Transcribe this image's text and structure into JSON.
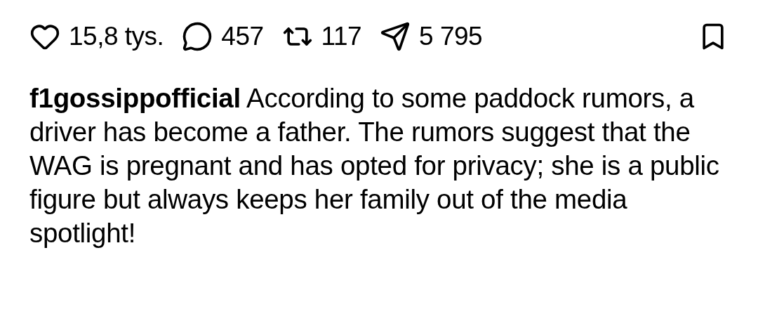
{
  "actions": [
    {
      "kind": "like",
      "count": "15,8 tys."
    },
    {
      "kind": "comment",
      "count": "457"
    },
    {
      "kind": "repost",
      "count": "117"
    },
    {
      "kind": "share",
      "count": "5 795"
    }
  ],
  "bookmark": {
    "kind": "save"
  },
  "caption": "**f1gossippofficial** According to some paddock rumors, a driver has become a father. The rumors suggest that the WAG is pregnant and has opted for privacy; she is a public figure but always keeps her family out of the media spotlight!"
}
